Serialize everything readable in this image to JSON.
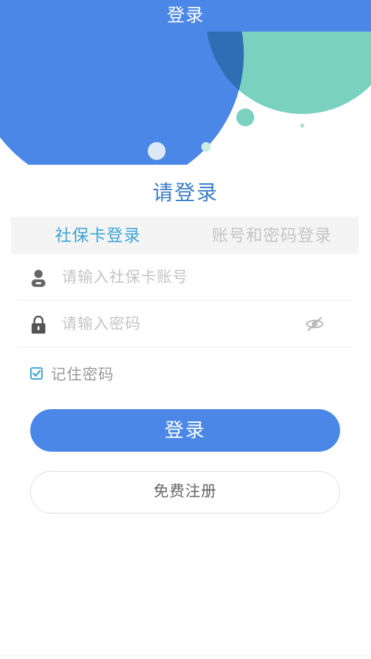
{
  "header": {
    "title": "登录"
  },
  "heading": "请登录",
  "tabs": [
    {
      "label": "社保卡登录",
      "active": true
    },
    {
      "label": "账号和密码登录",
      "active": false
    }
  ],
  "form": {
    "card_field": {
      "value": "",
      "placeholder": "请输入社保卡账号",
      "icon": "user-icon"
    },
    "password_field": {
      "value": "",
      "placeholder": "请输入密码",
      "icon": "lock-icon",
      "toggle_icon": "eye-hidden-icon"
    },
    "remember": {
      "label": "记住密码",
      "checked": true
    }
  },
  "buttons": {
    "login": "登录",
    "register": "免费注册"
  },
  "colors": {
    "primary_blue": "#4a87e6",
    "dark_blue": "#2f6db5",
    "teal": "#7ad1c0",
    "tab_active": "#3aa5d4",
    "heading": "#3a7dc9"
  }
}
